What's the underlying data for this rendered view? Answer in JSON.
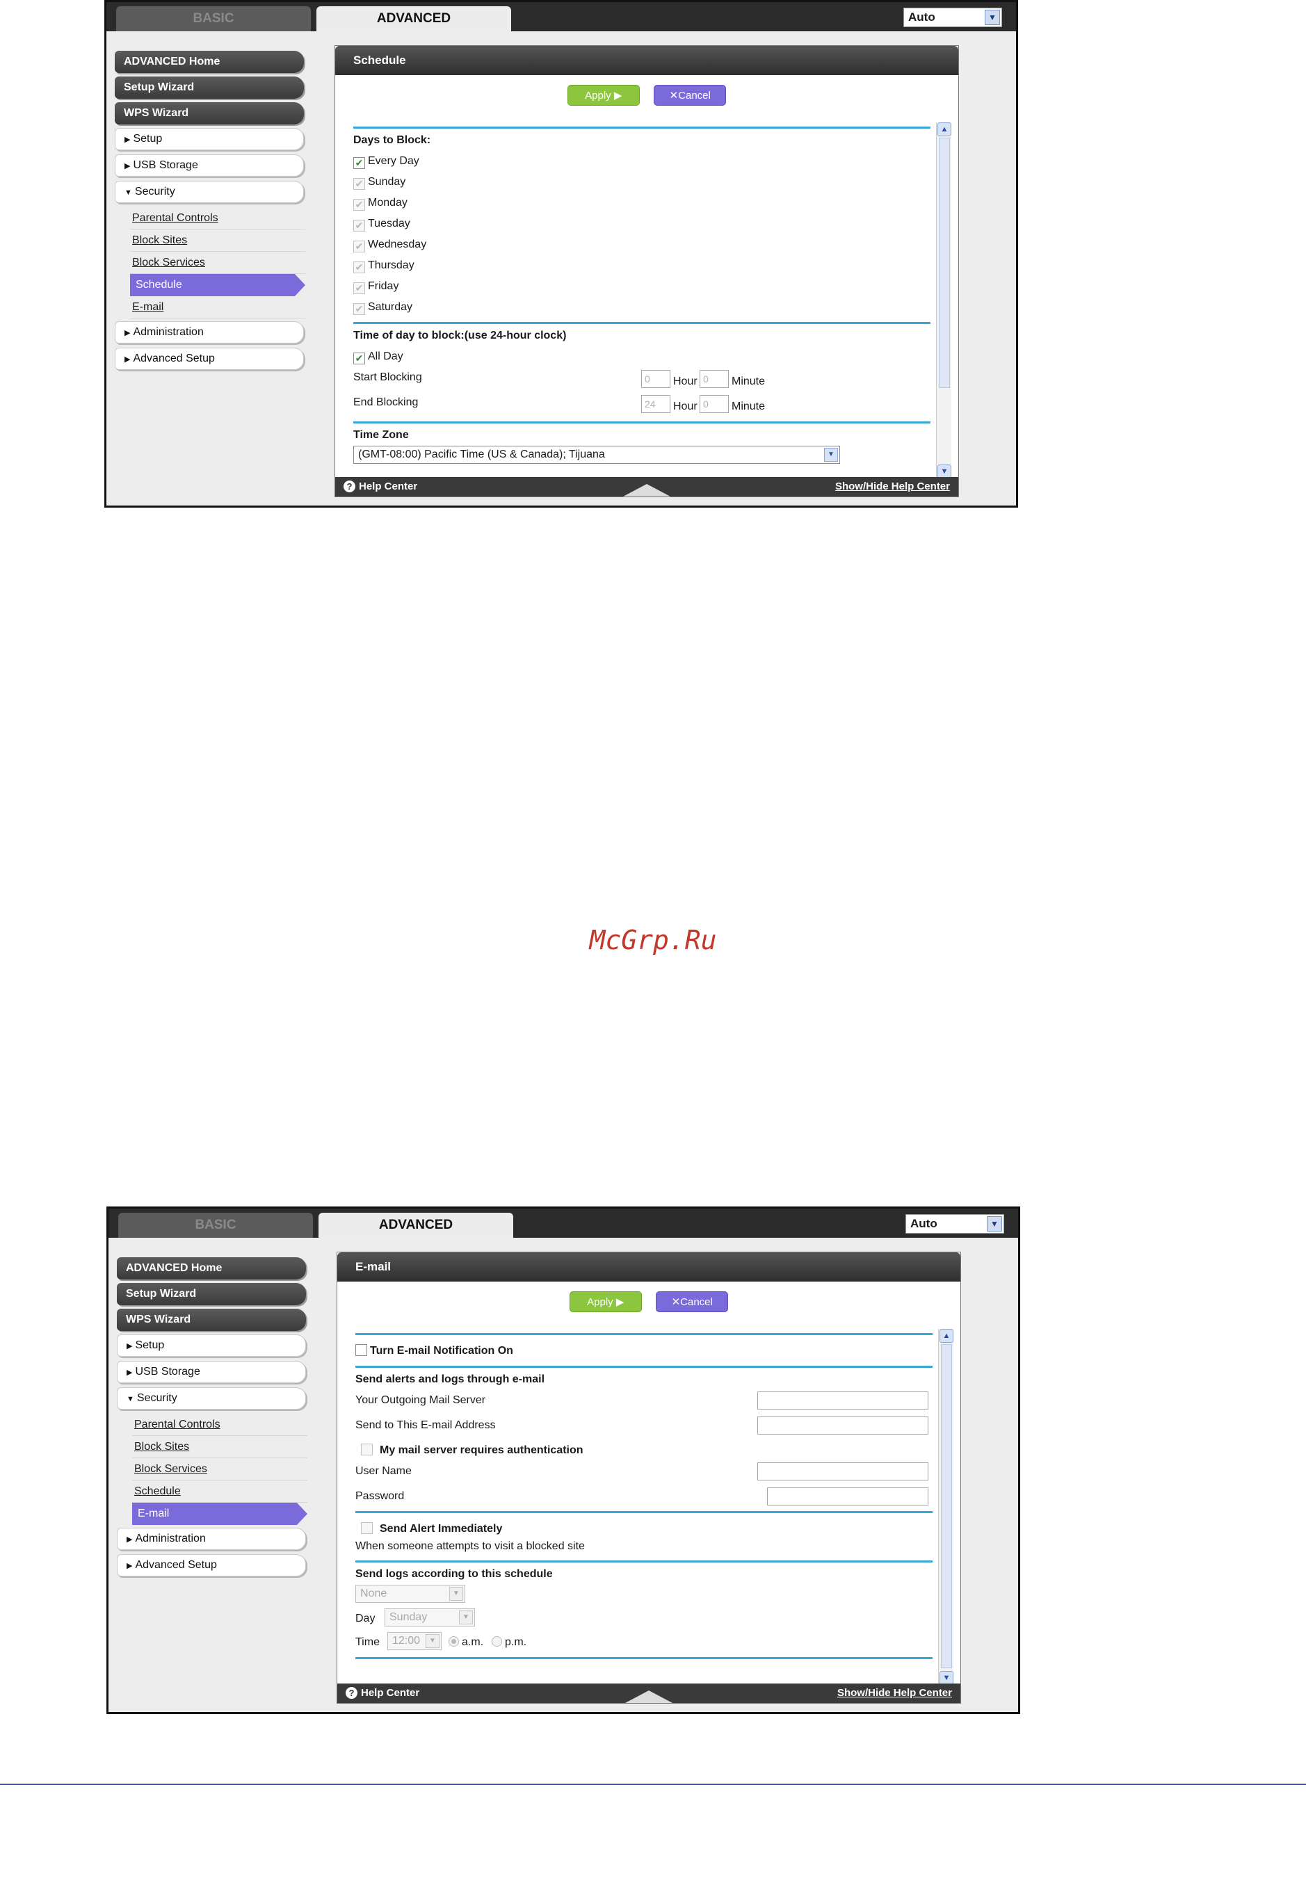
{
  "common": {
    "tab_basic": "BASIC",
    "tab_advanced": "ADVANCED",
    "language_value": "Auto",
    "nav_dark": [
      "ADVANCED Home",
      "Setup Wizard",
      "WPS Wizard"
    ],
    "nav_setup": "Setup",
    "nav_usb": "USB Storage",
    "nav_security": "Security",
    "nav_security_items": [
      "Parental Controls",
      "Block Sites",
      "Block Services",
      "Schedule",
      "E-mail"
    ],
    "nav_admin": "Administration",
    "nav_adv_setup": "Advanced Setup",
    "apply_label": "Apply ▶",
    "cancel_label": "✕Cancel",
    "help_center": "Help Center",
    "show_hide": "Show/Hide Help Center"
  },
  "schedule": {
    "title": "Schedule",
    "active_nav": "Schedule",
    "days_title": "Days to Block:",
    "every_day": "Every Day",
    "days": [
      "Sunday",
      "Monday",
      "Tuesday",
      "Wednesday",
      "Thursday",
      "Friday",
      "Saturday"
    ],
    "time_title": "Time of day to block:(use 24-hour clock)",
    "all_day": "All Day",
    "start_label": "Start Blocking",
    "end_label": "End Blocking",
    "start_hour": "0",
    "start_minute": "0",
    "end_hour": "24",
    "end_minute": "0",
    "hour_label": "Hour",
    "minute_label": "Minute",
    "tz_title": "Time Zone",
    "tz_value": "(GMT-08:00) Pacific Time (US & Canada); Tijuana"
  },
  "email": {
    "title": "E-mail",
    "active_nav": "E-mail",
    "turn_on": "Turn E-mail Notification On",
    "send_title": "Send alerts and logs through e-mail",
    "outgoing_server": "Your Outgoing Mail Server",
    "send_to": "Send to This E-mail Address",
    "auth_required": "My mail server requires authentication",
    "user_name": "User Name",
    "password": "Password",
    "send_alert": "Send Alert Immediately",
    "alert_desc": "When someone attempts to visit a blocked site",
    "logs_title": "Send logs according to this schedule",
    "schedule_value": "None",
    "day_label": "Day",
    "day_value": "Sunday",
    "time_label": "Time",
    "time_value": "12:00",
    "am": "a.m.",
    "pm": "p.m."
  },
  "watermark": "McGrp.Ru"
}
